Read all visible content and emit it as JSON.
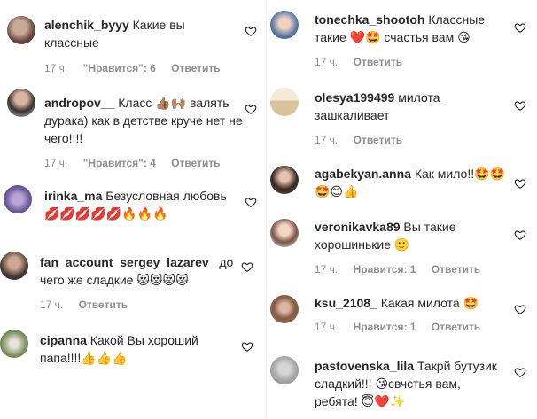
{
  "comments_left": [
    {
      "user": "alenchik_byyy",
      "text": "Какие вы классные",
      "time": "17 ч.",
      "likes": "\"Нравится\": 6",
      "reply": "Ответить"
    },
    {
      "user": "andropov__",
      "text": "Класс 👍🏽🙌🏽 валять дурака) как в детстве круче нет не чего!!!!",
      "time": "17 ч.",
      "likes": "\"Нравится\": 4",
      "reply": "Ответить"
    },
    {
      "user": "irinka_ma",
      "text": "Безусловная любовь 💋💋💋💋💋🔥🔥🔥",
      "time": "",
      "likes": "",
      "reply": ""
    },
    {
      "user": "fan_account_sergey_lazarev_",
      "text": "до чего же сладкие 😻😻😻😻",
      "time": "17 ч.",
      "likes": "",
      "reply": "Ответить"
    },
    {
      "user": "cipanna",
      "text": "Какой Вы хороший папа!!!!👍👍👍",
      "time": "",
      "likes": "",
      "reply": ""
    }
  ],
  "comments_right": [
    {
      "user": "tonechka_shootoh",
      "text": "Классные такие ❤️🤩 счастья вам 😘",
      "time": "17 ч.",
      "likes": "",
      "reply": "Ответить"
    },
    {
      "user": "olesya199499",
      "text": "милота зашкаливает",
      "time": "17 ч.",
      "likes": "",
      "reply": "Ответить"
    },
    {
      "user": "agabekyan.anna",
      "text": "Как мило!!🤩🤩🤩😊👍",
      "time": "17 ч.",
      "likes": "",
      "reply": "Ответить"
    },
    {
      "user": "veronikavka89",
      "text": "Вы такие хорошинькие 🙂",
      "time": "17 ч.",
      "likes": "Нравится: 1",
      "reply": "Ответить"
    },
    {
      "user": "ksu_2108_",
      "text": "Какая милота 🤩",
      "time": "17 ч.",
      "likes": "Нравится: 1",
      "reply": "Ответить"
    },
    {
      "user": "pastovenska_lila",
      "text": "Такрй бутузик сладкий!!! 😘свчстья вам, ребята! 😇❤️✨",
      "time": "",
      "likes": "",
      "reply": ""
    }
  ],
  "colors": {
    "text": "#262626",
    "meta": "#8e8e8e",
    "divider": "#efefef",
    "heart": "#262626"
  }
}
